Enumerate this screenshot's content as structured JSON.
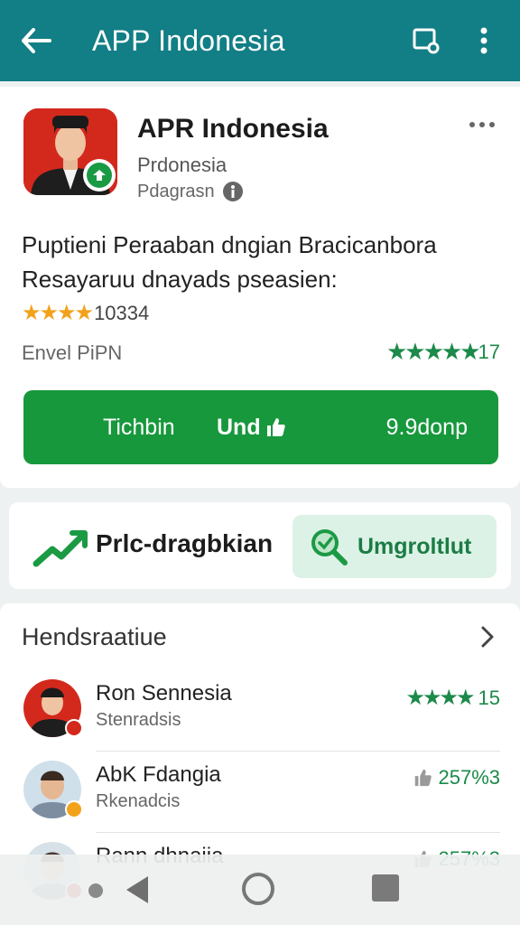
{
  "appbar": {
    "title": "APP Indonesia",
    "back_icon": "arrow-left-icon",
    "cast_icon": "cast-screen-icon",
    "menu_icon": "more-vert-icon"
  },
  "app": {
    "name": "APR Indonesia",
    "developer": "Prdonesia",
    "category": "Pdagrasn",
    "description_line1": "Puptieni Peraaban dngian Bracicanbora",
    "description_line2": "Resayaruu dnayads pseasien:",
    "rating_count": "10334",
    "meta_left": "Envel PiPN",
    "meta_right_value": "17",
    "install": {
      "left_label": "Tichbin",
      "center_label": "Und",
      "right_label": "9.9donp"
    }
  },
  "action": {
    "label": "Prlc-dragbkian",
    "button_label": "Umgroltlut"
  },
  "list": {
    "header": "Hendsraatiue",
    "items": [
      {
        "name": "Ron Sennesia",
        "sub": "Stenradsis",
        "rating": "15",
        "rating_type": "stars"
      },
      {
        "name": "AbK Fdangia",
        "sub": "Rkenadcis",
        "rating": "257%3",
        "rating_type": "thumb"
      },
      {
        "name": "Rann dhnaiia",
        "sub": "",
        "rating": "257%3",
        "rating_type": "thumb"
      }
    ]
  },
  "colors": {
    "appbar": "#127e85",
    "accent_green": "#17983c",
    "star_yellow": "#f2a21a",
    "icon_red": "#d3291d"
  }
}
